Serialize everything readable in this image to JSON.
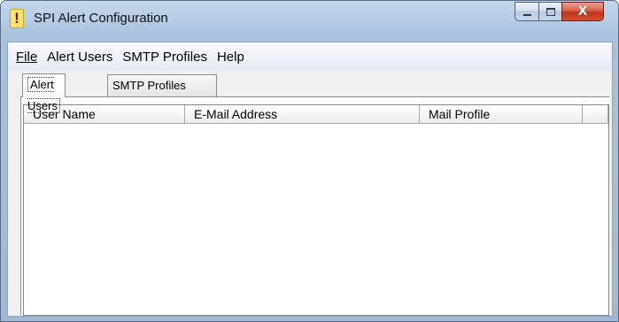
{
  "window": {
    "title": "SPI Alert Configuration",
    "icon": "exclamation-icon",
    "controls": {
      "minimize": "minimize-icon",
      "maximize": "maximize-icon",
      "close_glyph": "X"
    }
  },
  "menu": {
    "file": "File",
    "alert_users": "Alert Users",
    "smtp_profiles": "SMTP Profiles",
    "help": "Help"
  },
  "tabs": {
    "alert_users": "Alert Users",
    "smtp_profiles": "SMTP Profiles",
    "active": "Alert Users"
  },
  "table": {
    "columns": [
      "User Name",
      "E-Mail Address",
      "Mail Profile",
      ""
    ],
    "rows": []
  },
  "colors": {
    "frame": "#b7cde6",
    "client": "#f0f0f0",
    "close_button": "#c2341d",
    "app_icon": "#fde36a"
  }
}
